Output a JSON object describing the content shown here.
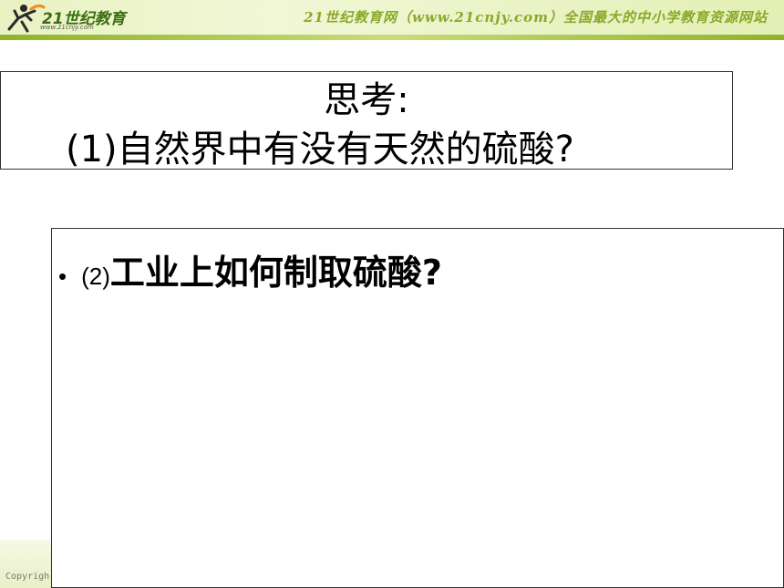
{
  "header": {
    "logo_text": "21世纪教育",
    "logo_sub": "www.21cnjy.com",
    "site_text": "21世纪教育网（www.21cnjy.com）全国最大的中小学教育资源网站"
  },
  "title": {
    "line1": "思考:",
    "line2": "(1)自然界中有没有天然的硫酸?"
  },
  "content": {
    "bullet": "•",
    "item_number": "(2)",
    "item_text": "工业上如何制取硫酸?"
  },
  "footer": {
    "copyright": "Copyrigh"
  },
  "colors": {
    "header_green": "#a8c43e",
    "site_text": "#8aa92a",
    "logo_orange": "#f08c1a"
  }
}
